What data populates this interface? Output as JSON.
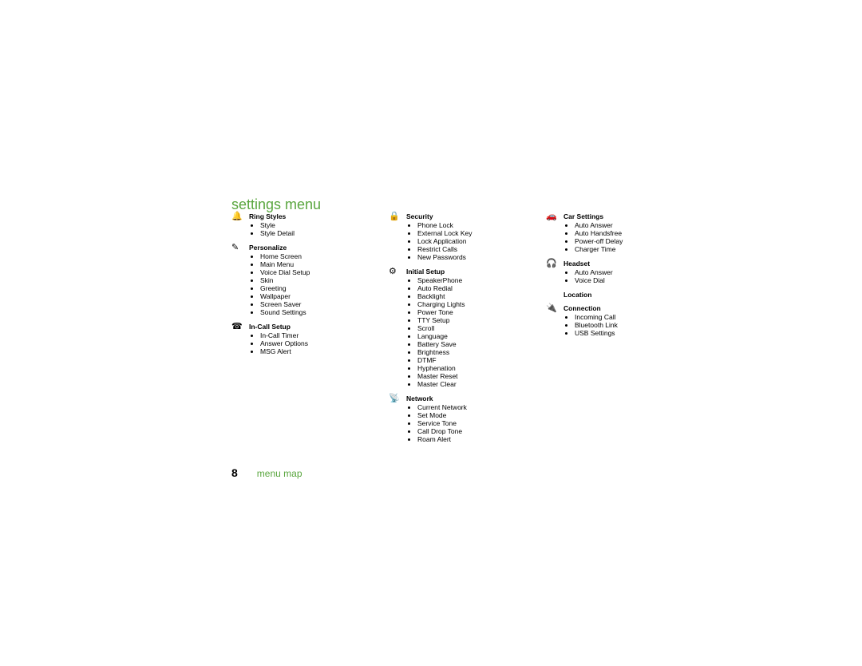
{
  "title": "settings menu",
  "page_number": "8",
  "footer_label": "menu map",
  "columns": [
    {
      "sections": [
        {
          "icon": "ring-icon",
          "glyph": "🔔",
          "heading": "Ring Styles",
          "items": [
            "Style",
            "Style Detail"
          ]
        },
        {
          "icon": "personalize-icon",
          "glyph": "✎",
          "heading": "Personalize",
          "items": [
            "Home Screen",
            "Main Menu",
            "Voice Dial Setup",
            "Skin",
            "Greeting",
            "Wallpaper",
            "Screen Saver",
            "Sound Settings"
          ]
        },
        {
          "icon": "in-call-icon",
          "glyph": "☎",
          "heading": "In-Call Setup",
          "items": [
            "In-Call Timer",
            "Answer Options",
            "MSG Alert"
          ]
        }
      ]
    },
    {
      "sections": [
        {
          "icon": "security-icon",
          "glyph": "🔒",
          "heading": "Security",
          "items": [
            "Phone Lock",
            "External Lock Key",
            "Lock Application",
            "Restrict Calls",
            "New Passwords"
          ]
        },
        {
          "icon": "initial-setup-icon",
          "glyph": "⚙",
          "heading": "Initial Setup",
          "items": [
            "SpeakerPhone",
            "Auto Redial",
            "Backlight",
            "Charging Lights",
            "Power Tone",
            "TTY Setup",
            "Scroll",
            "Language",
            "Battery Save",
            "Brightness",
            "DTMF",
            "Hyphenation",
            "Master Reset",
            "Master Clear"
          ]
        },
        {
          "icon": "network-icon",
          "glyph": "📡",
          "heading": "Network",
          "items": [
            "Current Network",
            "Set Mode",
            "Service Tone",
            "Call Drop Tone",
            "Roam Alert"
          ]
        }
      ]
    },
    {
      "sections": [
        {
          "icon": "car-icon",
          "glyph": "🚗",
          "heading": "Car Settings",
          "items": [
            "Auto Answer",
            "Auto Handsfree",
            "Power-off Delay",
            "Charger Time"
          ]
        },
        {
          "icon": "headset-icon",
          "glyph": "🎧",
          "heading": "Headset",
          "items": [
            "Auto Answer",
            "Voice Dial"
          ]
        },
        {
          "icon": "location-icon",
          "glyph": "",
          "heading": "Location",
          "items": []
        },
        {
          "icon": "connection-icon",
          "glyph": "🔌",
          "heading": "Connection",
          "items": [
            "Incoming Call",
            "Bluetooth Link",
            "USB Settings"
          ]
        }
      ]
    }
  ]
}
